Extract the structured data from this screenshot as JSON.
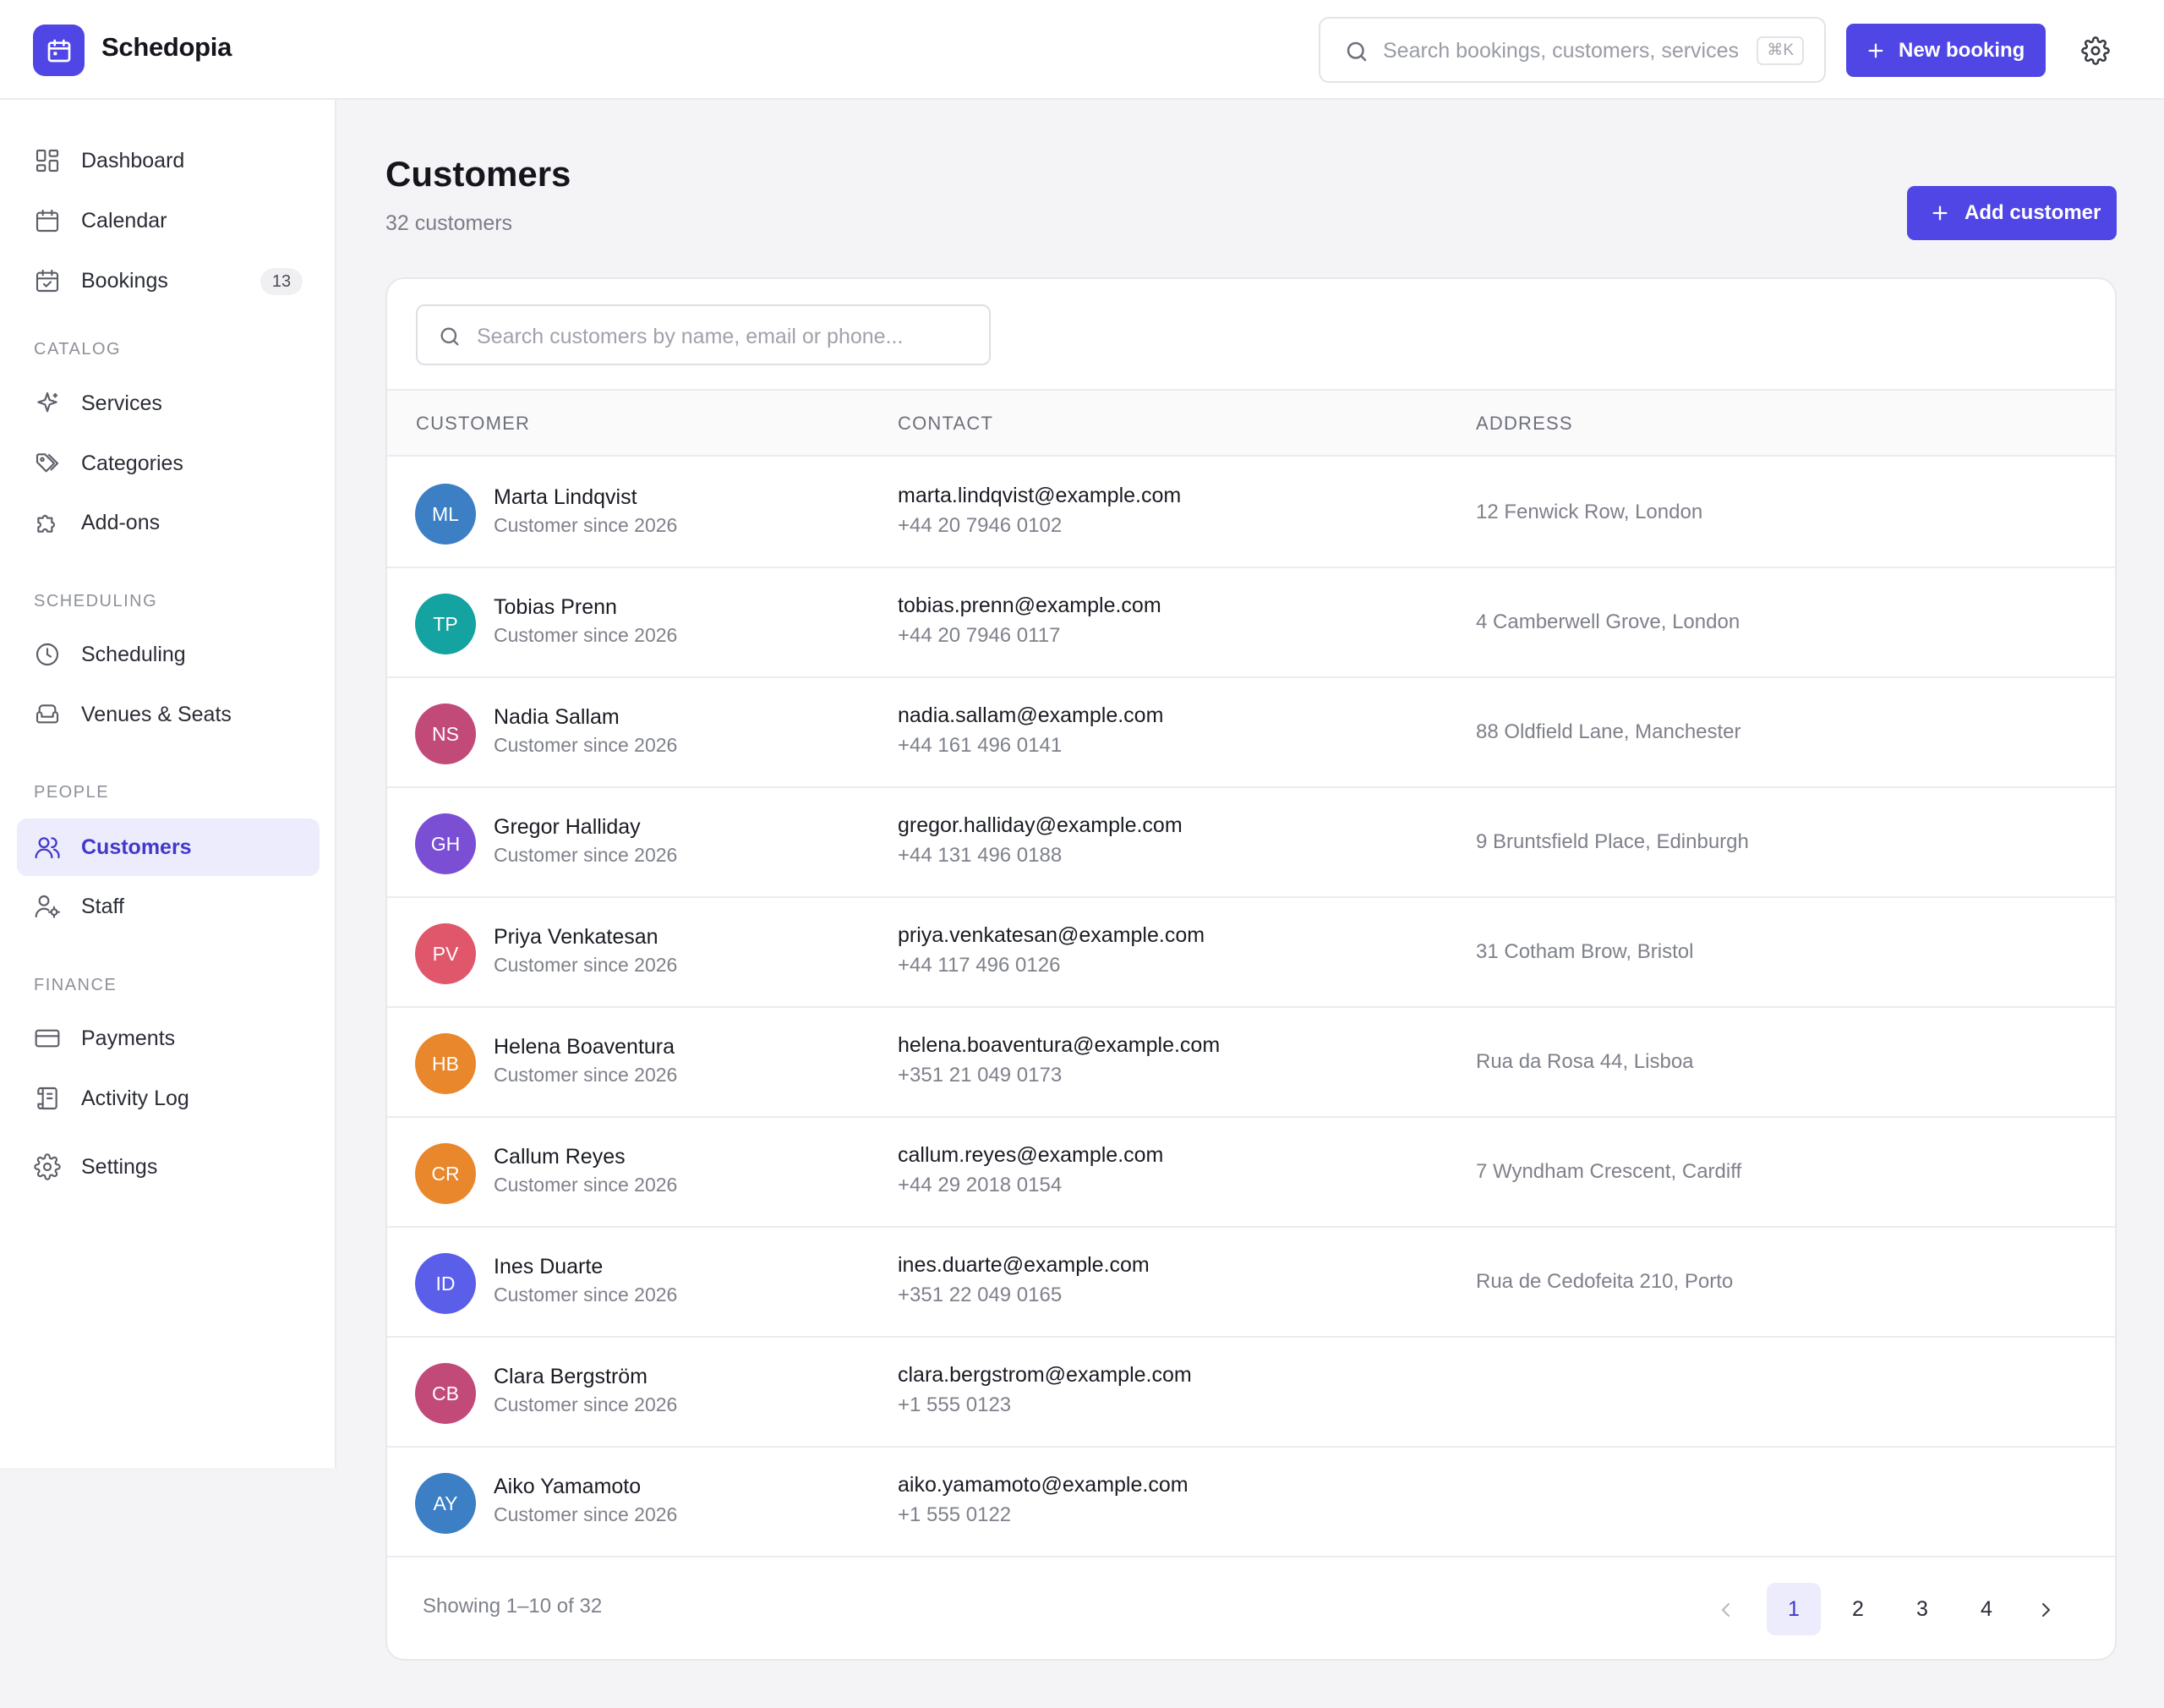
{
  "app": {
    "brand": "Schedopia"
  },
  "header": {
    "search_placeholder": "Search bookings, customers, services",
    "search_shortcut": "⌘K",
    "new_booking_label": "New booking"
  },
  "sidebar": {
    "items": [
      {
        "label": "Dashboard",
        "icon": "dashboard-icon"
      },
      {
        "label": "Calendar",
        "icon": "calendar-icon"
      },
      {
        "label": "Bookings",
        "icon": "bookings-icon",
        "badge": "13"
      }
    ],
    "sections": [
      {
        "label": "CATALOG",
        "items": [
          {
            "label": "Services",
            "icon": "sparkle-icon"
          },
          {
            "label": "Categories",
            "icon": "tags-icon"
          },
          {
            "label": "Add-ons",
            "icon": "puzzle-icon"
          }
        ]
      },
      {
        "label": "SCHEDULING",
        "items": [
          {
            "label": "Scheduling",
            "icon": "clock-icon"
          },
          {
            "label": "Venues & Seats",
            "icon": "armchair-icon"
          }
        ]
      },
      {
        "label": "PEOPLE",
        "items": [
          {
            "label": "Customers",
            "icon": "users-icon",
            "active": true
          },
          {
            "label": "Staff",
            "icon": "staff-icon"
          }
        ]
      },
      {
        "label": "FINANCE",
        "items": [
          {
            "label": "Payments",
            "icon": "credit-card-icon"
          },
          {
            "label": "Activity Log",
            "icon": "scroll-icon"
          }
        ]
      }
    ],
    "settings_label": "Settings"
  },
  "page": {
    "title": "Customers",
    "subtitle": "32 customers",
    "add_label": "Add customer",
    "search_placeholder": "Search customers by name, email or phone..."
  },
  "table": {
    "columns": [
      "CUSTOMER",
      "CONTACT",
      "ADDRESS"
    ],
    "rows": [
      {
        "initials": "ML",
        "color": "#3d7fc4",
        "name": "Marta Lindqvist",
        "since": "Customer since 2026",
        "email": "marta.lindqvist@example.com",
        "phone": "+44 20 7946 0102",
        "address": "12 Fenwick Row, London"
      },
      {
        "initials": "TP",
        "color": "#14a3a0",
        "name": "Tobias Prenn",
        "since": "Customer since 2026",
        "email": "tobias.prenn@example.com",
        "phone": "+44 20 7946 0117",
        "address": "4 Camberwell Grove, London"
      },
      {
        "initials": "NS",
        "color": "#c24a79",
        "name": "Nadia Sallam",
        "since": "Customer since 2026",
        "email": "nadia.sallam@example.com",
        "phone": "+44 161 496 0141",
        "address": "88 Oldfield Lane, Manchester"
      },
      {
        "initials": "GH",
        "color": "#7b4fd3",
        "name": "Gregor Halliday",
        "since": "Customer since 2026",
        "email": "gregor.halliday@example.com",
        "phone": "+44 131 496 0188",
        "address": "9 Bruntsfield Place, Edinburgh"
      },
      {
        "initials": "PV",
        "color": "#e0566b",
        "name": "Priya Venkatesan",
        "since": "Customer since 2026",
        "email": "priya.venkatesan@example.com",
        "phone": "+44 117 496 0126",
        "address": "31 Cotham Brow, Bristol"
      },
      {
        "initials": "HB",
        "color": "#e8872b",
        "name": "Helena Boaventura",
        "since": "Customer since 2026",
        "email": "helena.boaventura@example.com",
        "phone": "+351 21 049 0173",
        "address": "Rua da Rosa 44, Lisboa"
      },
      {
        "initials": "CR",
        "color": "#e8872b",
        "name": "Callum Reyes",
        "since": "Customer since 2026",
        "email": "callum.reyes@example.com",
        "phone": "+44 29 2018 0154",
        "address": "7 Wyndham Crescent, Cardiff"
      },
      {
        "initials": "ID",
        "color": "#5b5ee8",
        "name": "Ines Duarte",
        "since": "Customer since 2026",
        "email": "ines.duarte@example.com",
        "phone": "+351 22 049 0165",
        "address": "Rua de Cedofeita 210, Porto"
      },
      {
        "initials": "CB",
        "color": "#c24a79",
        "name": "Clara Bergström",
        "since": "Customer since 2026",
        "email": "clara.bergstrom@example.com",
        "phone": "+1 555 0123",
        "address": ""
      },
      {
        "initials": "AY",
        "color": "#3d7fc4",
        "name": "Aiko Yamamoto",
        "since": "Customer since 2026",
        "email": "aiko.yamamoto@example.com",
        "phone": "+1 555 0122",
        "address": ""
      }
    ]
  },
  "pagination": {
    "summary": "Showing 1–10 of 32",
    "pages": [
      "1",
      "2",
      "3",
      "4"
    ],
    "current": "1"
  },
  "colors": {
    "accent": "#4f46e5",
    "active_bg": "#ececfd"
  }
}
